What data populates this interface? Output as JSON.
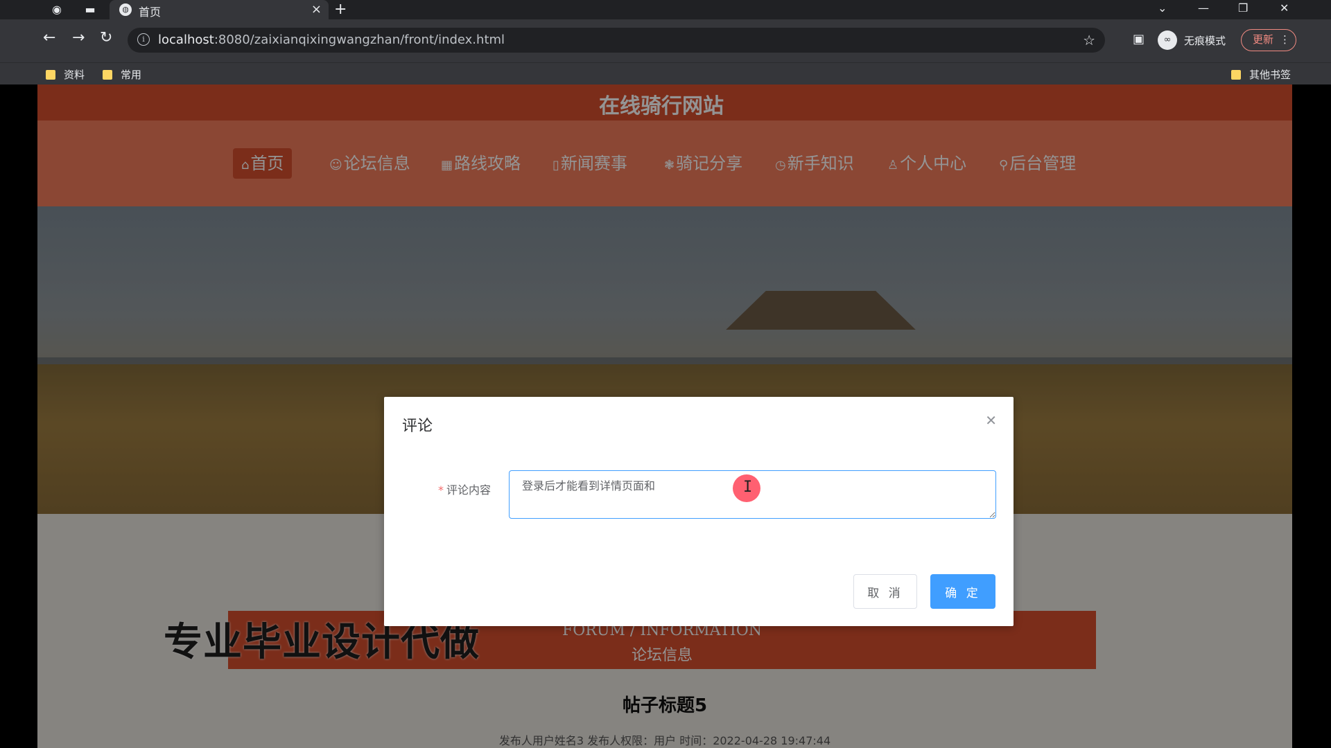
{
  "browser": {
    "tab_title": "首页",
    "url_host": "localhost",
    "url_rest": ":8080/zaixianqixingwangzhan/front/index.html",
    "incognito_label": "无痕模式",
    "update_label": "更新",
    "bookmarks": [
      "资料",
      "常用"
    ],
    "other_bookmarks": "其他书签"
  },
  "site": {
    "title": "在线骑行网站",
    "nav": [
      {
        "icon": "⌂",
        "label": "首页"
      },
      {
        "icon": "☺",
        "label": "论坛信息"
      },
      {
        "icon": "▦",
        "label": "路线攻略"
      },
      {
        "icon": "▯",
        "label": "新闻赛事"
      },
      {
        "icon": "❃",
        "label": "骑记分享"
      },
      {
        "icon": "◷",
        "label": "新手知识"
      },
      {
        "icon": "♙",
        "label": "个人中心"
      },
      {
        "icon": "⚲",
        "label": "后台管理"
      }
    ],
    "active_nav": "首页",
    "watermark": "专业毕业设计代做",
    "section_en": "FORUM / INFORMATION",
    "section_cn": "论坛信息",
    "post_title": "帖子标题5",
    "post_meta": "发布人用户姓名3   发布人权限：用户   时间：2022-04-28 19:47:44"
  },
  "dialog": {
    "title": "评论",
    "field_label": "评论内容",
    "field_value": "登录后才能看到详情页面和",
    "cancel_label": "取 消",
    "ok_label": "确 定"
  },
  "colors": {
    "brand": "#d54e2d",
    "nav_bg": "#ef7a5b",
    "primary": "#409eff"
  }
}
